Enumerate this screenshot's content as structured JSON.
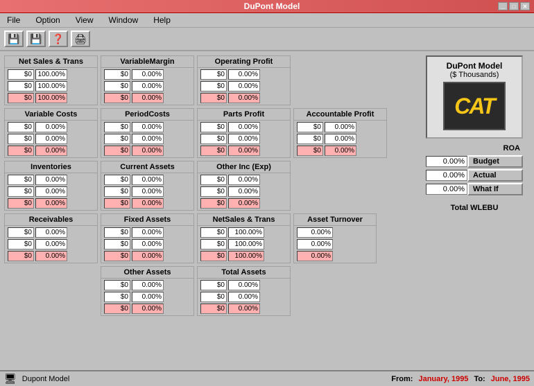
{
  "window": {
    "title": "DuPont Model",
    "minimize": "_",
    "maximize": "□",
    "close": "✕"
  },
  "menu": {
    "items": [
      "File",
      "Option",
      "View",
      "Window",
      "Help"
    ]
  },
  "toolbar": {
    "icons": [
      "💾",
      "💾",
      "❓",
      "🖨"
    ]
  },
  "model_info": {
    "title": "DuPont Model",
    "subtitle": "($ Thousands)",
    "cat_text": "CAT"
  },
  "roa": {
    "header": "ROA",
    "rows": [
      {
        "value": "0.00%",
        "label": "Budget"
      },
      {
        "value": "0.00%",
        "label": "Actual"
      },
      {
        "value": "0.00%",
        "label": "What If"
      }
    ]
  },
  "total_wlebu": "Total WLEBU",
  "widgets": {
    "net_sales": {
      "title": "Net Sales & Trans",
      "rows": [
        {
          "val": "$0",
          "pct": "100.00%"
        },
        {
          "val": "$0",
          "pct": "100.00%"
        },
        {
          "val": "$0",
          "pct": "100.00%",
          "pink": true
        }
      ]
    },
    "variable_margin": {
      "title": "VariableMargin",
      "rows": [
        {
          "val": "$0",
          "pct": "0.00%"
        },
        {
          "val": "$0",
          "pct": "0.00%"
        },
        {
          "val": "$0",
          "pct": "0.00%",
          "pink": true
        }
      ]
    },
    "operating_profit": {
      "title": "Operating Profit",
      "rows": [
        {
          "val": "$0",
          "pct": "0.00%"
        },
        {
          "val": "$0",
          "pct": "0.00%"
        },
        {
          "val": "$0",
          "pct": "0.00%",
          "pink": true
        }
      ]
    },
    "variable_costs": {
      "title": "Variable Costs",
      "rows": [
        {
          "val": "$0",
          "pct": "0.00%"
        },
        {
          "val": "$0",
          "pct": "0.00%"
        },
        {
          "val": "$0",
          "pct": "0.00%",
          "pink": true
        }
      ]
    },
    "period_costs": {
      "title": "PeriodCosts",
      "rows": [
        {
          "val": "$0",
          "pct": "0.00%"
        },
        {
          "val": "$0",
          "pct": "0.00%"
        },
        {
          "val": "$0",
          "pct": "0.00%",
          "pink": true
        }
      ]
    },
    "parts_profit": {
      "title": "Parts Profit",
      "rows": [
        {
          "val": "$0",
          "pct": "0.00%"
        },
        {
          "val": "$0",
          "pct": "0.00%"
        },
        {
          "val": "$0",
          "pct": "0.00%",
          "pink": true
        }
      ]
    },
    "accountable_profit": {
      "title": "Accountable Profit",
      "rows": [
        {
          "val": "$0",
          "pct": "0.00%"
        },
        {
          "val": "$0",
          "pct": "0.00%"
        },
        {
          "val": "$0",
          "pct": "0.00%",
          "pink": true
        }
      ]
    },
    "inventories": {
      "title": "Inventories",
      "rows": [
        {
          "val": "$0",
          "pct": "0.00%"
        },
        {
          "val": "$0",
          "pct": "0.00%"
        },
        {
          "val": "$0",
          "pct": "0.00%",
          "pink": true
        }
      ]
    },
    "current_assets": {
      "title": "Current Assets",
      "rows": [
        {
          "val": "$0",
          "pct": "0.00%"
        },
        {
          "val": "$0",
          "pct": "0.00%"
        },
        {
          "val": "$0",
          "pct": "0.00%",
          "pink": true
        }
      ]
    },
    "other_inc_exp": {
      "title": "Other Inc (Exp)",
      "rows": [
        {
          "val": "$0",
          "pct": "0.00%"
        },
        {
          "val": "$0",
          "pct": "0.00%"
        },
        {
          "val": "$0",
          "pct": "0.00%",
          "pink": true
        }
      ]
    },
    "receivables": {
      "title": "Receivables",
      "rows": [
        {
          "val": "$0",
          "pct": "0.00%"
        },
        {
          "val": "$0",
          "pct": "0.00%"
        },
        {
          "val": "$0",
          "pct": "0.00%",
          "pink": true
        }
      ]
    },
    "fixed_assets": {
      "title": "Fixed Assets",
      "rows": [
        {
          "val": "$0",
          "pct": "0.00%"
        },
        {
          "val": "$0",
          "pct": "0.00%"
        },
        {
          "val": "$0",
          "pct": "0.00%",
          "pink": true
        }
      ]
    },
    "netsales_trans": {
      "title": "NetSales & Trans",
      "rows": [
        {
          "val": "$0",
          "pct": "100.00%"
        },
        {
          "val": "$0",
          "pct": "100.00%"
        },
        {
          "val": "$0",
          "pct": "100.00%",
          "pink": true
        }
      ]
    },
    "asset_turnover": {
      "title": "Asset Turnover",
      "rows": [
        {
          "val": "0.00%"
        },
        {
          "val": "0.00%"
        },
        {
          "val": "0.00%",
          "pink": true
        }
      ]
    },
    "other_assets": {
      "title": "Other Assets",
      "rows": [
        {
          "val": "$0",
          "pct": "0.00%"
        },
        {
          "val": "$0",
          "pct": "0.00%"
        },
        {
          "val": "$0",
          "pct": "0.00%",
          "pink": true
        }
      ]
    },
    "total_assets": {
      "title": "Total Assets",
      "rows": [
        {
          "val": "$0",
          "pct": "0.00%"
        },
        {
          "val": "$0",
          "pct": "0.00%"
        },
        {
          "val": "$0",
          "pct": "0.00%",
          "pink": true
        }
      ]
    }
  },
  "status": {
    "app_name": "Dupont Model",
    "from_label": "From:",
    "from_date": "January, 1995",
    "to_label": "To:",
    "to_date": "June, 1995"
  }
}
